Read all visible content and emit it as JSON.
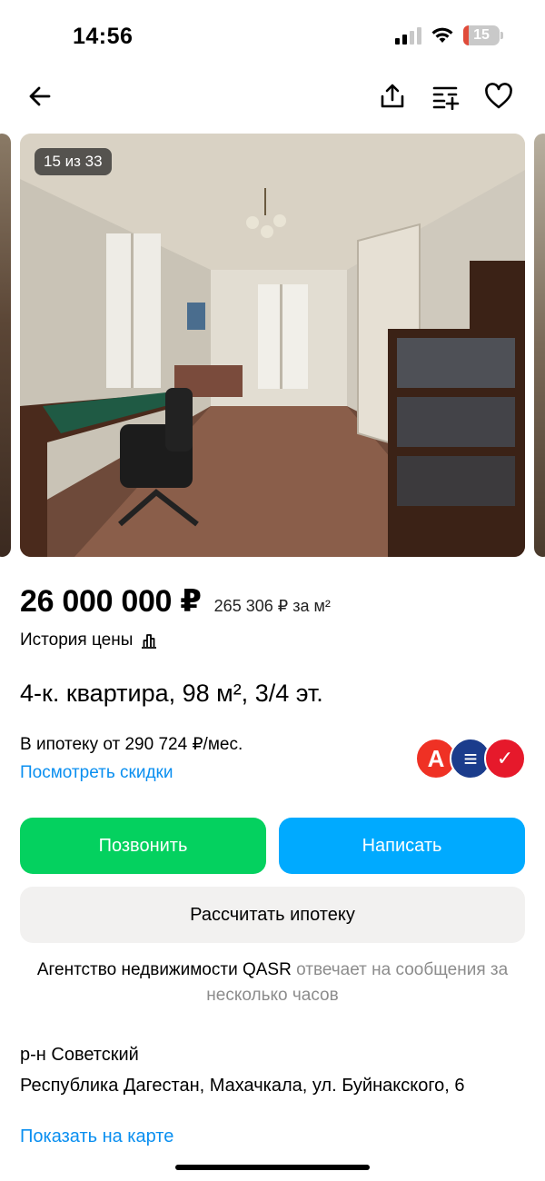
{
  "status_bar": {
    "time": "14:56",
    "battery": "15",
    "battery_level": 0.15
  },
  "nav": {
    "back_icon": "arrow-left-icon",
    "share_icon": "share-icon",
    "compare_icon": "compare-list-icon",
    "favorite_icon": "heart-icon"
  },
  "gallery": {
    "counter": "15 из 33"
  },
  "listing": {
    "price": "26 000 000 ₽",
    "price_per_m2": "265 306 ₽ за м²",
    "price_history": "История цены",
    "title": "4-к. квартира, 98 м², 3/4 эт."
  },
  "mortgage": {
    "text": "В ипотеку от 290 724 ₽/мес.",
    "discount_link": "Посмотреть скидки",
    "banks": [
      {
        "glyph": "А",
        "color": "#ef3124"
      },
      {
        "glyph": "≡",
        "color": "#1b3c8c"
      },
      {
        "glyph": "✓",
        "color": "#e6192b"
      }
    ]
  },
  "actions": {
    "call": "Позвонить",
    "write": "Написать",
    "calc": "Рассчитать ипотеку"
  },
  "agency": {
    "name": "Агентство недвижимости QASR",
    "reply": " отвечает на сообщения за несколько часов"
  },
  "location": {
    "district": "р-н Советский",
    "address": "Республика Дагестан, Махачкала, ул. Буйнакского, 6",
    "map_link": "Показать на карте"
  },
  "colors": {
    "call": "#04d15f",
    "write": "#00aaff",
    "link": "#0a8ff0"
  }
}
